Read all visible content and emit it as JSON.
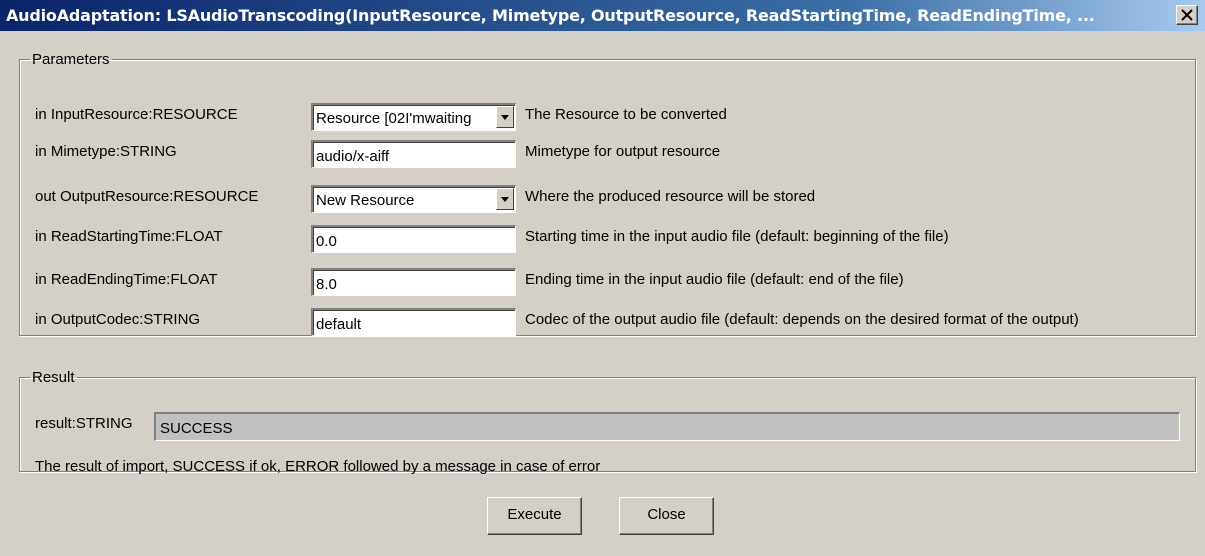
{
  "window": {
    "title": "AudioAdaptation: LSAudioTranscoding(InputResource, Mimetype, OutputResource, ReadStartingTime, ReadEndingTime, ..."
  },
  "parameters": {
    "legend": "Parameters",
    "rows": [
      {
        "label": "in InputResource:RESOURCE",
        "value": "Resource [02I'mwaiting",
        "description": "The Resource to be converted",
        "control": "dropdown"
      },
      {
        "label": "in Mimetype:STRING",
        "value": "audio/x-aiff",
        "description": "Mimetype for output resource",
        "control": "text"
      },
      {
        "label": "out OutputResource:RESOURCE",
        "value": "New Resource",
        "description": "Where the produced resource will be stored",
        "control": "dropdown"
      },
      {
        "label": "in ReadStartingTime:FLOAT",
        "value": "0.0",
        "description": "Starting time in the input audio file (default: beginning of the file)",
        "control": "text"
      },
      {
        "label": "in ReadEndingTime:FLOAT",
        "value": "8.0",
        "description": "Ending time in the input audio file (default: end of the file)",
        "control": "text"
      },
      {
        "label": "in OutputCodec:STRING",
        "value": "default",
        "description": "Codec of the output audio file (default: depends on the desired format of the output)",
        "control": "text"
      }
    ]
  },
  "result": {
    "legend": "Result",
    "label": "result:STRING",
    "value": "SUCCESS",
    "description": "The result of import, SUCCESS if ok, ERROR followed by a message in case of error"
  },
  "buttons": {
    "execute": "Execute",
    "close": "Close"
  },
  "colors": {
    "dialog_bg": "#d4d0c8",
    "titlebar_start": "#0a246a",
    "titlebar_end": "#a6caf0",
    "result_field_bg": "#c0c0c0"
  }
}
